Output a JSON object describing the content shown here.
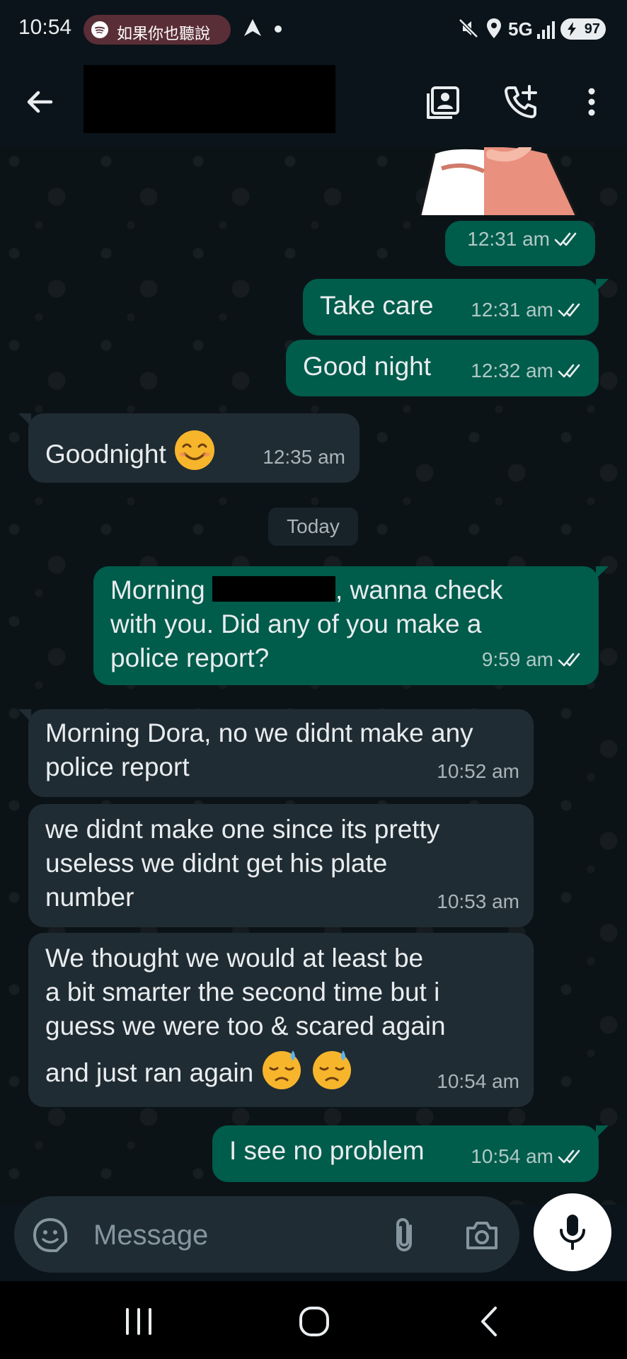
{
  "status_bar": {
    "time": "10:54",
    "now_playing": "如果你也聽說",
    "network": "5G",
    "battery": "97"
  },
  "header": {
    "contact_name": "",
    "icons": [
      "back-arrow-icon",
      "contact-card-icon",
      "add-call-icon",
      "more-vert-icon"
    ]
  },
  "messages": [
    {
      "dir": "out",
      "type": "sticker",
      "time": "12:31 am"
    },
    {
      "dir": "out",
      "text": "Take care",
      "time": "12:31 am"
    },
    {
      "dir": "out",
      "text": "Good night",
      "time": "12:32 am"
    },
    {
      "dir": "in",
      "text": "Goodnight",
      "emoji": "smiling-face-emoji",
      "time": "12:35 am"
    },
    {
      "dir": "out",
      "text_before": "Morning",
      "text_after": ", wanna check",
      "line2": "with you. Did any of you make a",
      "line3": "police report?",
      "time": "9:59 am"
    },
    {
      "dir": "in",
      "line1": "Morning Dora, no we didnt make any",
      "line2": "police report",
      "time": "10:52 am"
    },
    {
      "dir": "in",
      "line1": "we didnt make one since its pretty",
      "line2": "useless we didnt get his plate",
      "line3": "number",
      "time": "10:53 am"
    },
    {
      "dir": "in",
      "line1": "We thought we would at least be",
      "line2": "a bit smarter the second time but i",
      "line3": "guess we were too & scared again",
      "line4": "and just ran again",
      "emoji": "downcast-sweat-emoji",
      "time": "10:54 am"
    },
    {
      "dir": "out",
      "text": "I see no problem",
      "time": "10:54 am"
    }
  ],
  "date_divider": "Today",
  "composer": {
    "placeholder": "Message"
  },
  "colors": {
    "background": "#0b141a",
    "outgoing_bubble": "#005c4b",
    "incoming_bubble": "#202c33"
  }
}
